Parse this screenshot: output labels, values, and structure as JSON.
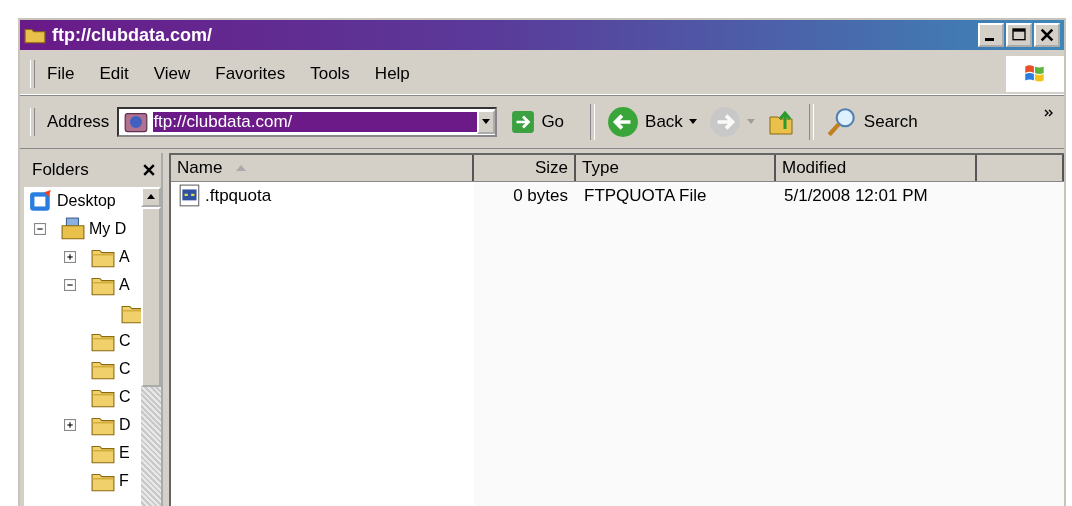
{
  "window": {
    "title": "ftp://clubdata.com/"
  },
  "menu": [
    {
      "label": "File"
    },
    {
      "label": "Edit"
    },
    {
      "label": "View"
    },
    {
      "label": "Favorites"
    },
    {
      "label": "Tools"
    },
    {
      "label": "Help"
    }
  ],
  "address": {
    "label": "Address",
    "value": "ftp://clubdata.com/",
    "selected": true,
    "go": "Go"
  },
  "toolbar": {
    "back": "Back",
    "search": "Search"
  },
  "folders": {
    "title": "Folders",
    "tree": [
      {
        "label": "Desktop",
        "kind": "desktop",
        "children": [
          {
            "label": "My D",
            "kind": "documents",
            "expanded": true,
            "children": [
              {
                "label": "A",
                "kind": "folder",
                "expanded": false
              },
              {
                "label": "A",
                "kind": "folder",
                "expanded": true,
                "children": [
                  {
                    "kind": "folder"
                  }
                ]
              },
              {
                "label": "C",
                "kind": "folder"
              },
              {
                "label": "C",
                "kind": "folder"
              },
              {
                "label": "C",
                "kind": "folder"
              },
              {
                "label": "D",
                "kind": "folder",
                "expanded": false
              },
              {
                "label": "E",
                "kind": "folder"
              },
              {
                "label": "F",
                "kind": "folder"
              }
            ]
          }
        ]
      }
    ]
  },
  "files": {
    "columns": [
      {
        "label": "Name",
        "sorted": true
      },
      {
        "label": "Size",
        "sorted": false
      },
      {
        "label": "Type",
        "sorted": false
      },
      {
        "label": "Modified",
        "sorted": false
      }
    ],
    "rows": [
      {
        "name": ".ftpquota",
        "size": "0 bytes",
        "type": "FTPQUOTA File",
        "modified": "5/1/2008 12:01 PM"
      }
    ]
  }
}
